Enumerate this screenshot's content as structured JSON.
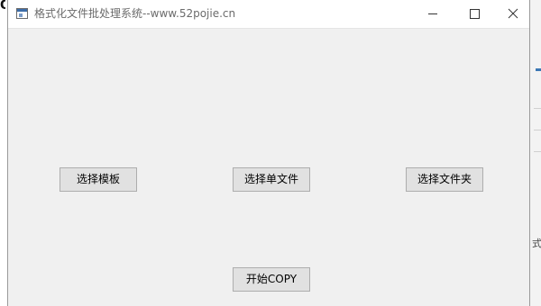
{
  "background": {
    "right_glyph": "式",
    "accent_color": "#3c78b4"
  },
  "window": {
    "title": "格式化文件批处理系统--www.52pojie.cn",
    "icon": "app-window-icon",
    "controls": {
      "minimize_icon": "minimize-icon",
      "maximize_icon": "maximize-icon",
      "close_icon": "close-icon"
    },
    "background_color": "#f0f0f0"
  },
  "buttons": {
    "select_template": "选择模板",
    "select_single_file": "选择单文件",
    "select_folder": "选择文件夹",
    "start_copy": "开始COPY"
  },
  "colors": {
    "button_face": "#e1e1e1",
    "button_border": "#adadad",
    "title_text": "#6b6b6b"
  }
}
